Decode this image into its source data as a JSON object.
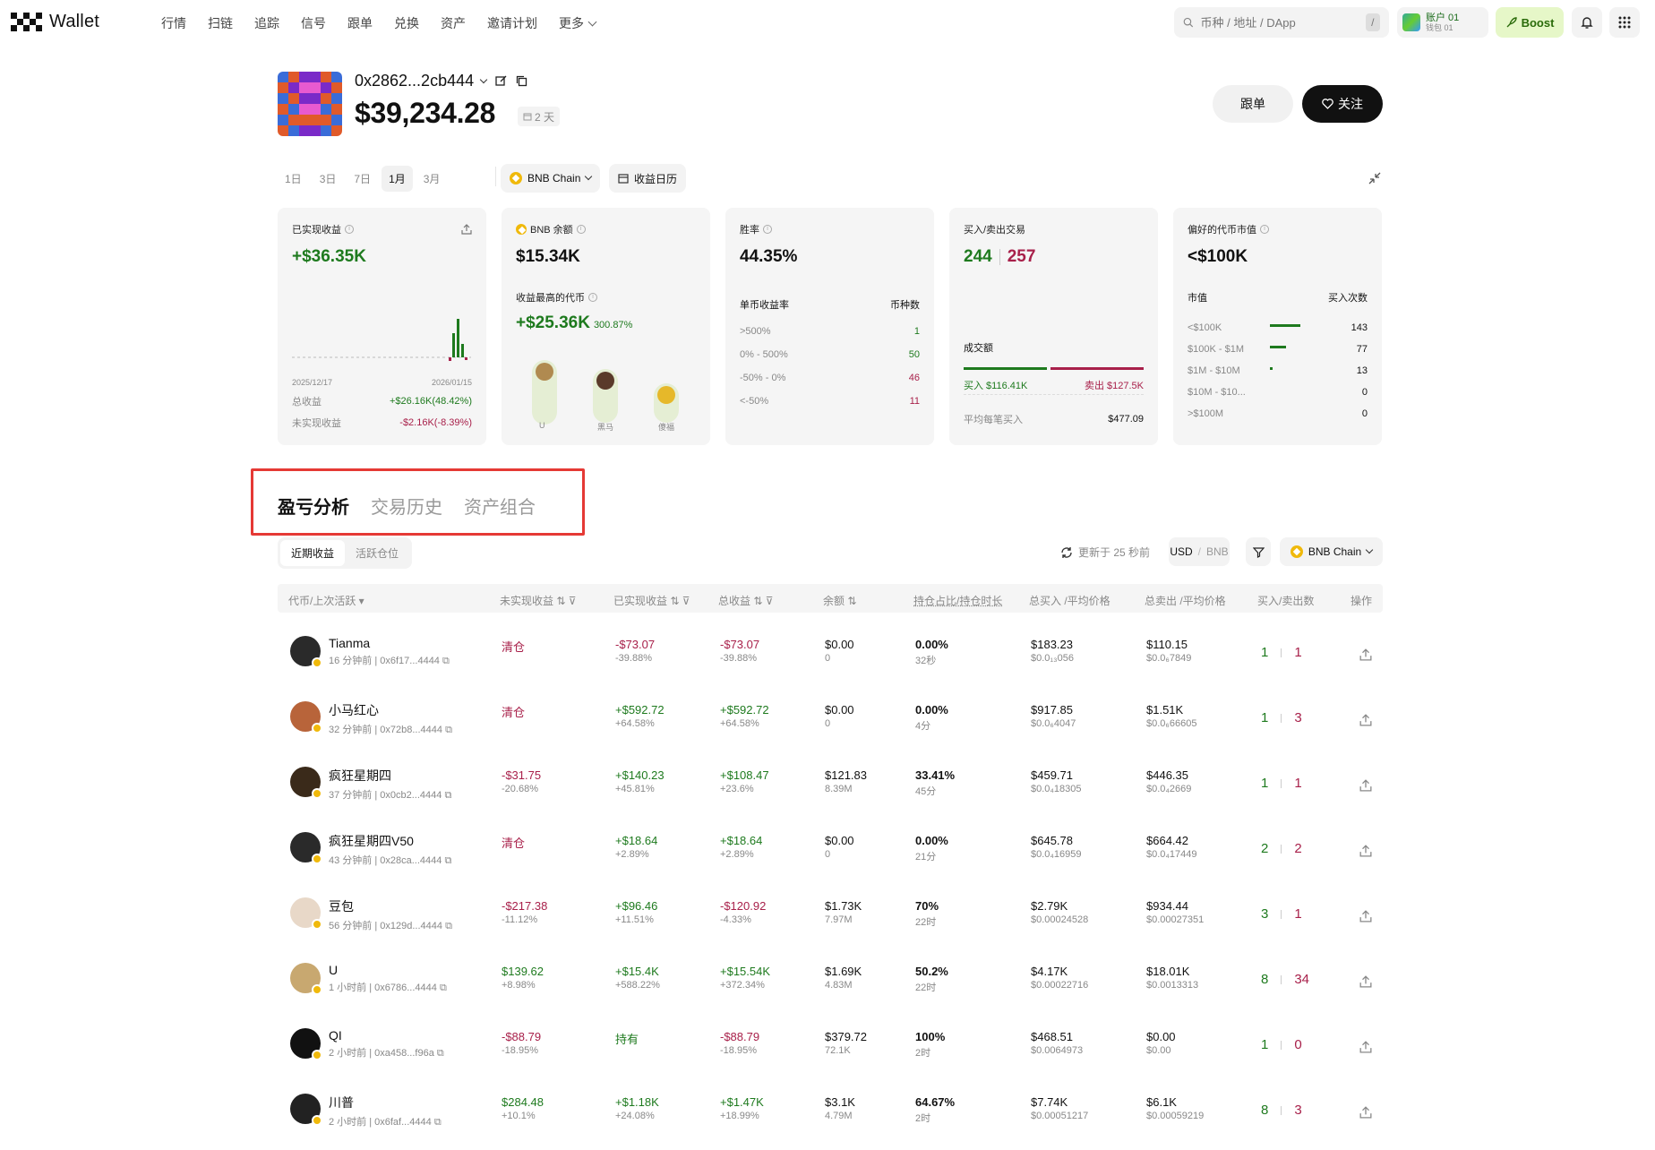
{
  "brand": {
    "wallet_label": "Wallet"
  },
  "nav": {
    "items": [
      "行情",
      "扫链",
      "追踪",
      "信号",
      "跟单",
      "兑换",
      "资产",
      "邀请计划"
    ],
    "more": "更多"
  },
  "search": {
    "placeholder": "币种 / 地址 / DApp",
    "shortcut": "/"
  },
  "account": {
    "name": "账户 01",
    "wallet": "钱包 01"
  },
  "boost": {
    "label": "Boost"
  },
  "profile": {
    "address": "0x2862...2cb444",
    "balance": "$39,234.28",
    "days": "2 天",
    "copy_trade": "跟单",
    "follow": "关注"
  },
  "periods": {
    "items": [
      "1日",
      "3日",
      "7日",
      "1月",
      "3月"
    ],
    "active": "1月"
  },
  "chain": {
    "label": "BNB Chain"
  },
  "calendar": {
    "label": "收益日历"
  },
  "cards": {
    "realized": {
      "title": "已实现收益",
      "value": "+$36.35K",
      "date_start": "2025/12/17",
      "date_end": "2026/01/15",
      "total_label": "总收益",
      "total_value": "+$26.16K(48.42%)",
      "unrealized_label": "未实现收益",
      "unrealized_value": "-$2.16K(-8.39%)"
    },
    "bnb": {
      "title": "BNB 余额",
      "value": "$15.34K",
      "top_label": "收益最高的代币",
      "top_value": "+$25.36K",
      "top_pct": "300.87%",
      "tokens": [
        "U",
        "黑马",
        "傻福"
      ]
    },
    "winrate": {
      "title": "胜率",
      "value": "44.35%",
      "col1": "单币收益率",
      "col2": "币种数",
      "rows": [
        {
          "range": ">500%",
          "count": "1"
        },
        {
          "range": "0% - 500%",
          "count": "50"
        },
        {
          "range": "-50% - 0%",
          "count": "46"
        },
        {
          "range": "<-50%",
          "count": "11"
        }
      ]
    },
    "trades": {
      "title": "买入/卖出交易",
      "buys": "244",
      "sells": "257",
      "volume_label": "成交额",
      "buy_vol": "买入 $116.41K",
      "sell_vol": "卖出 $127.5K",
      "avg_label": "平均每笔买入",
      "avg_value": "$477.09"
    },
    "mcap": {
      "title": "偏好的代币市值",
      "value": "<$100K",
      "col1": "市值",
      "col2": "买入次数",
      "rows": [
        {
          "range": "<$100K",
          "count": "143",
          "frac": 1.0
        },
        {
          "range": "$100K - $1M",
          "count": "77",
          "frac": 0.54
        },
        {
          "range": "$1M - $10M",
          "count": "13",
          "frac": 0.09
        },
        {
          "range": "$10M - $10...",
          "count": "0",
          "frac": 0
        },
        {
          "range": ">$100M",
          "count": "0",
          "frac": 0
        }
      ]
    }
  },
  "tabs": {
    "items": [
      "盈亏分析",
      "交易历史",
      "资产组合"
    ]
  },
  "subtabs": {
    "items": [
      "近期收益",
      "活跃仓位"
    ]
  },
  "toolbar": {
    "updated": "更新于 25 秒前",
    "usd": "USD",
    "bnb": "BNB",
    "chain": "BNB Chain"
  },
  "table": {
    "headers": [
      "代币/上次活跃",
      "未实现收益",
      "已实现收益",
      "总收益",
      "余额",
      "持仓占比/持仓时长",
      "总买入 /平均价格",
      "总卖出 /平均价格",
      "买入/卖出数",
      "操作"
    ],
    "rows": [
      {
        "name": "Tianma",
        "sub": "16 分钟前 | 0x6f17...4444",
        "unreal": "清仓",
        "unreal_sub": "",
        "real": "-$73.07",
        "real_sub": "-39.88%",
        "total": "-$73.07",
        "total_sub": "-39.88%",
        "bal": "$0.00",
        "bal_sub": "0",
        "hold": "0.00%",
        "hold_sub": "32秒",
        "buy": "$183.23",
        "buy_sub": "$0.0₁₃056",
        "sell": "$110.15",
        "sell_sub": "$0.0₆7849",
        "nb": "1",
        "ns": "1",
        "uc": "red",
        "rc": "red",
        "tc": "red"
      },
      {
        "name": "小马红心",
        "sub": "32 分钟前 | 0x72b8...4444",
        "unreal": "清仓",
        "unreal_sub": "",
        "real": "+$592.72",
        "real_sub": "+64.58%",
        "total": "+$592.72",
        "total_sub": "+64.58%",
        "bal": "$0.00",
        "bal_sub": "0",
        "hold": "0.00%",
        "hold_sub": "4分",
        "buy": "$917.85",
        "buy_sub": "$0.0₆4047",
        "sell": "$1.51K",
        "sell_sub": "$0.0₆66605",
        "nb": "1",
        "ns": "3",
        "uc": "red",
        "rc": "green",
        "tc": "green"
      },
      {
        "name": "疯狂星期四",
        "sub": "37 分钟前 | 0x0cb2...4444",
        "unreal": "-$31.75",
        "unreal_sub": "-20.68%",
        "real": "+$140.23",
        "real_sub": "+45.81%",
        "total": "+$108.47",
        "total_sub": "+23.6%",
        "bal": "$121.83",
        "bal_sub": "8.39M",
        "hold": "33.41%",
        "hold_sub": "45分",
        "buy": "$459.71",
        "buy_sub": "$0.0₄18305",
        "sell": "$446.35",
        "sell_sub": "$0.0₄2669",
        "nb": "1",
        "ns": "1",
        "uc": "red",
        "rc": "green",
        "tc": "green"
      },
      {
        "name": "疯狂星期四V50",
        "sub": "43 分钟前 | 0x28ca...4444",
        "unreal": "清仓",
        "unreal_sub": "",
        "real": "+$18.64",
        "real_sub": "+2.89%",
        "total": "+$18.64",
        "total_sub": "+2.89%",
        "bal": "$0.00",
        "bal_sub": "0",
        "hold": "0.00%",
        "hold_sub": "21分",
        "buy": "$645.78",
        "buy_sub": "$0.0₄16959",
        "sell": "$664.42",
        "sell_sub": "$0.0₄17449",
        "nb": "2",
        "ns": "2",
        "uc": "red",
        "rc": "green",
        "tc": "green"
      },
      {
        "name": "豆包",
        "sub": "56 分钟前 | 0x129d...4444",
        "unreal": "-$217.38",
        "unreal_sub": "-11.12%",
        "real": "+$96.46",
        "real_sub": "+11.51%",
        "total": "-$120.92",
        "total_sub": "-4.33%",
        "bal": "$1.73K",
        "bal_sub": "7.97M",
        "hold": "70%",
        "hold_sub": "22时",
        "buy": "$2.79K",
        "buy_sub": "$0.00024528",
        "sell": "$934.44",
        "sell_sub": "$0.00027351",
        "nb": "3",
        "ns": "1",
        "uc": "red",
        "rc": "green",
        "tc": "red"
      },
      {
        "name": "U",
        "sub": "1 小时前 | 0x6786...4444",
        "unreal": "$139.62",
        "unreal_sub": "+8.98%",
        "real": "+$15.4K",
        "real_sub": "+588.22%",
        "total": "+$15.54K",
        "total_sub": "+372.34%",
        "bal": "$1.69K",
        "bal_sub": "4.83M",
        "hold": "50.2%",
        "hold_sub": "22时",
        "buy": "$4.17K",
        "buy_sub": "$0.00022716",
        "sell": "$18.01K",
        "sell_sub": "$0.0013313",
        "nb": "8",
        "ns": "34",
        "uc": "green",
        "rc": "green",
        "tc": "green"
      },
      {
        "name": "QI",
        "sub": "2 小时前 | 0xa458...f96a",
        "unreal": "-$88.79",
        "unreal_sub": "-18.95%",
        "real": "持有",
        "real_sub": "",
        "total": "-$88.79",
        "total_sub": "-18.95%",
        "bal": "$379.72",
        "bal_sub": "72.1K",
        "hold": "100%",
        "hold_sub": "2时",
        "buy": "$468.51",
        "buy_sub": "$0.0064973",
        "sell": "$0.00",
        "sell_sub": "$0.00",
        "nb": "1",
        "ns": "0",
        "uc": "red",
        "rc": "green",
        "tc": "red"
      },
      {
        "name": "川普",
        "sub": "2 小时前 | 0x6faf...4444",
        "unreal": "$284.48",
        "unreal_sub": "+10.1%",
        "real": "+$1.18K",
        "real_sub": "+24.08%",
        "total": "+$1.47K",
        "total_sub": "+18.99%",
        "bal": "$3.1K",
        "bal_sub": "4.79M",
        "hold": "64.67%",
        "hold_sub": "2时",
        "buy": "$7.74K",
        "buy_sub": "$0.00051217",
        "sell": "$6.1K",
        "sell_sub": "$0.00059219",
        "nb": "8",
        "ns": "3",
        "uc": "green",
        "rc": "green",
        "tc": "green"
      }
    ]
  },
  "colors": {
    "green": "#1e7a1e",
    "red": "#a8204a",
    "highlight": "#e53935"
  }
}
